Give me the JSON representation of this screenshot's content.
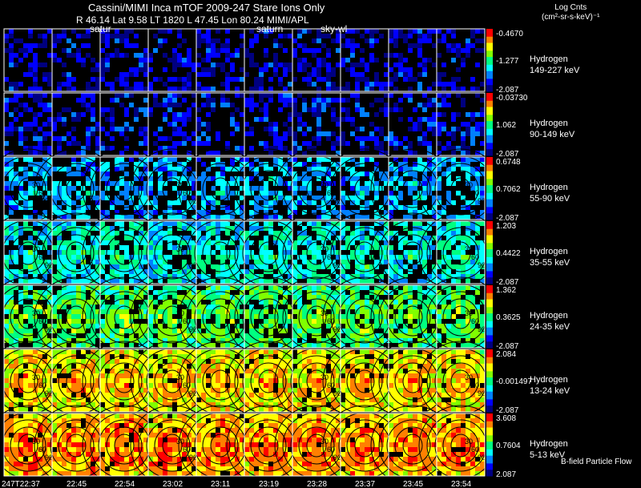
{
  "header": {
    "title": "Cassini/MIMI Inca mTOF  2009-247   Stare    Ions Only",
    "subtitle": "R       46.14 Lat 9.58 LT 1820 L        47.45 Lon       80.24  MIMI/APL"
  },
  "colorbar": {
    "label_line1": "Log Cnts",
    "label_line2": "(cm²-sr-s-keV)⁻¹"
  },
  "target_labels": [
    "satur",
    "saturn",
    "sky-wl"
  ],
  "footer": {
    "bfield_label": "B-field Particle Flow"
  },
  "chart_data": {
    "type": "heatmap",
    "title": "Cassini/MIMI Inca mTOF  2009-247   Stare    Ions Only",
    "x_tick_labels": [
      "247T22:37",
      "22:45",
      "22:54",
      "23:02",
      "23:11",
      "23:19",
      "23:28",
      "23:37",
      "23:45",
      "23:54"
    ],
    "frames_per_row": 10,
    "contour_levels": [
      30,
      60,
      90,
      120,
      150
    ],
    "colormap": [
      "#000080",
      "#0000ff",
      "#0080ff",
      "#00ffff",
      "#00ff80",
      "#80ff00",
      "#ffff00",
      "#ff8000",
      "#ff0000"
    ],
    "rows": [
      {
        "species": "Hydrogen",
        "energy": "149-227 keV",
        "cb_max": "-0.4670",
        "cb_mid": "-1.277",
        "cb_min": "-2.087"
      },
      {
        "species": "Hydrogen",
        "energy": "90-149 keV",
        "cb_max": "-0.03730",
        "cb_mid": "1.062",
        "cb_min": "-2.087"
      },
      {
        "species": "Hydrogen",
        "energy": "55-90 keV",
        "cb_max": "0.6748",
        "cb_mid": "0.7062",
        "cb_min": "-2.087"
      },
      {
        "species": "Hydrogen",
        "energy": "35-55 keV",
        "cb_max": "1.203",
        "cb_mid": "0.4422",
        "cb_min": "-2.087"
      },
      {
        "species": "Hydrogen",
        "energy": "24-35 keV",
        "cb_max": "1.362",
        "cb_mid": "0.3625",
        "cb_min": "-2.087"
      },
      {
        "species": "Hydrogen",
        "energy": "13-24 keV",
        "cb_max": "2.084",
        "cb_mid": "-0.001497",
        "cb_min": "-2.087"
      },
      {
        "species": "Hydrogen",
        "energy": "5-13 keV",
        "cb_max": "3.608",
        "cb_mid": "0.7604",
        "cb_min": "2.087"
      }
    ]
  }
}
